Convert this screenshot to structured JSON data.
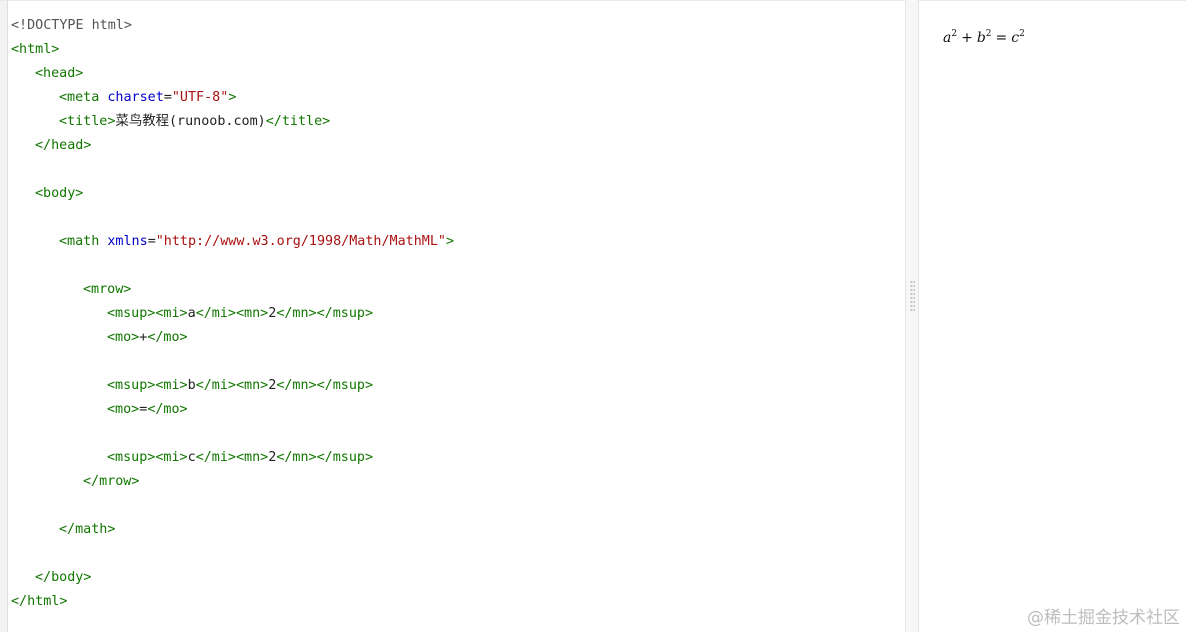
{
  "editor": {
    "lines": [
      {
        "indent": 0,
        "tokens": [
          {
            "t": "meta",
            "v": "<!DOCTYPE html>"
          }
        ]
      },
      {
        "indent": 0,
        "tokens": [
          {
            "t": "tag",
            "v": "<html>"
          }
        ]
      },
      {
        "indent": 1,
        "tokens": [
          {
            "t": "tag",
            "v": "<head>"
          }
        ]
      },
      {
        "indent": 2,
        "tokens": [
          {
            "t": "tag",
            "v": "<meta "
          },
          {
            "t": "attr",
            "v": "charset"
          },
          {
            "t": "text",
            "v": "="
          },
          {
            "t": "str",
            "v": "\"UTF-8\""
          },
          {
            "t": "tag",
            "v": ">"
          }
        ]
      },
      {
        "indent": 2,
        "tokens": [
          {
            "t": "tag",
            "v": "<title>"
          },
          {
            "t": "text",
            "v": "菜鸟教程(runoob.com)"
          },
          {
            "t": "tag",
            "v": "</title>"
          }
        ]
      },
      {
        "indent": 1,
        "tokens": [
          {
            "t": "tag",
            "v": "</head>"
          }
        ]
      },
      {
        "indent": 0,
        "tokens": []
      },
      {
        "indent": 1,
        "tokens": [
          {
            "t": "tag",
            "v": "<body>"
          }
        ]
      },
      {
        "indent": 0,
        "tokens": []
      },
      {
        "indent": 2,
        "tokens": [
          {
            "t": "tag",
            "v": "<math "
          },
          {
            "t": "attr",
            "v": "xmlns"
          },
          {
            "t": "text",
            "v": "="
          },
          {
            "t": "str",
            "v": "\"http://www.w3.org/1998/Math/MathML\""
          },
          {
            "t": "tag",
            "v": ">"
          }
        ]
      },
      {
        "indent": 0,
        "tokens": []
      },
      {
        "indent": 3,
        "tokens": [
          {
            "t": "tag",
            "v": "<mrow>"
          }
        ]
      },
      {
        "indent": 4,
        "tokens": [
          {
            "t": "tag",
            "v": "<msup><mi>"
          },
          {
            "t": "text",
            "v": "a"
          },
          {
            "t": "tag",
            "v": "</mi><mn>"
          },
          {
            "t": "text",
            "v": "2"
          },
          {
            "t": "tag",
            "v": "</mn></msup>"
          }
        ]
      },
      {
        "indent": 4,
        "tokens": [
          {
            "t": "tag",
            "v": "<mo>"
          },
          {
            "t": "text",
            "v": "+"
          },
          {
            "t": "tag",
            "v": "</mo>"
          }
        ]
      },
      {
        "indent": 0,
        "tokens": []
      },
      {
        "indent": 4,
        "tokens": [
          {
            "t": "tag",
            "v": "<msup><mi>"
          },
          {
            "t": "text",
            "v": "b"
          },
          {
            "t": "tag",
            "v": "</mi><mn>"
          },
          {
            "t": "text",
            "v": "2"
          },
          {
            "t": "tag",
            "v": "</mn></msup>"
          }
        ]
      },
      {
        "indent": 4,
        "tokens": [
          {
            "t": "tag",
            "v": "<mo>"
          },
          {
            "t": "text",
            "v": "="
          },
          {
            "t": "tag",
            "v": "</mo>"
          }
        ]
      },
      {
        "indent": 0,
        "tokens": []
      },
      {
        "indent": 4,
        "tokens": [
          {
            "t": "tag",
            "v": "<msup><mi>"
          },
          {
            "t": "text",
            "v": "c"
          },
          {
            "t": "tag",
            "v": "</mi><mn>"
          },
          {
            "t": "text",
            "v": "2"
          },
          {
            "t": "tag",
            "v": "</mn></msup>"
          }
        ]
      },
      {
        "indent": 3,
        "tokens": [
          {
            "t": "tag",
            "v": "</mrow>"
          }
        ]
      },
      {
        "indent": 0,
        "tokens": []
      },
      {
        "indent": 2,
        "tokens": [
          {
            "t": "tag",
            "v": "</math>"
          }
        ]
      },
      {
        "indent": 0,
        "tokens": []
      },
      {
        "indent": 1,
        "tokens": [
          {
            "t": "tag",
            "v": "</body>"
          }
        ]
      },
      {
        "indent": 0,
        "tokens": [
          {
            "t": "tag",
            "v": "</html>"
          }
        ]
      }
    ]
  },
  "preview": {
    "formula": {
      "a": "a",
      "b": "b",
      "c": "c",
      "exp": "2",
      "plus": "+",
      "equals": "="
    }
  },
  "watermark": "@稀土掘金技术社区"
}
